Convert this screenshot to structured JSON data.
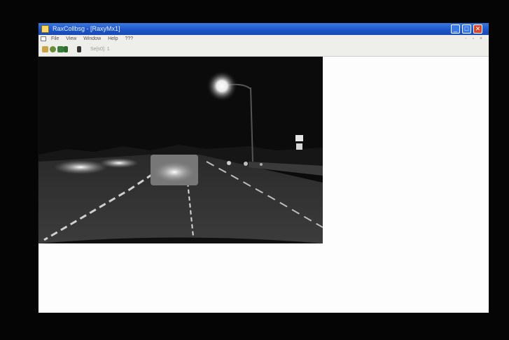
{
  "window": {
    "title": "RaxCollbsg - [RaxyMx1]",
    "controls": {
      "minimize": "_",
      "maximize": "□",
      "close": "✕"
    }
  },
  "menu": {
    "items": [
      "File",
      "View",
      "Window",
      "Help",
      "???"
    ],
    "mdi_controls": "- ▫ ×"
  },
  "toolbar": {
    "field_text": "Se[s0]: 1"
  },
  "video": {
    "description_icon": "camera-frame"
  },
  "colors": {
    "titlebar": "#1e56c8",
    "close": "#d8462a",
    "client": "#fdfdfd",
    "outer": "#050505"
  }
}
